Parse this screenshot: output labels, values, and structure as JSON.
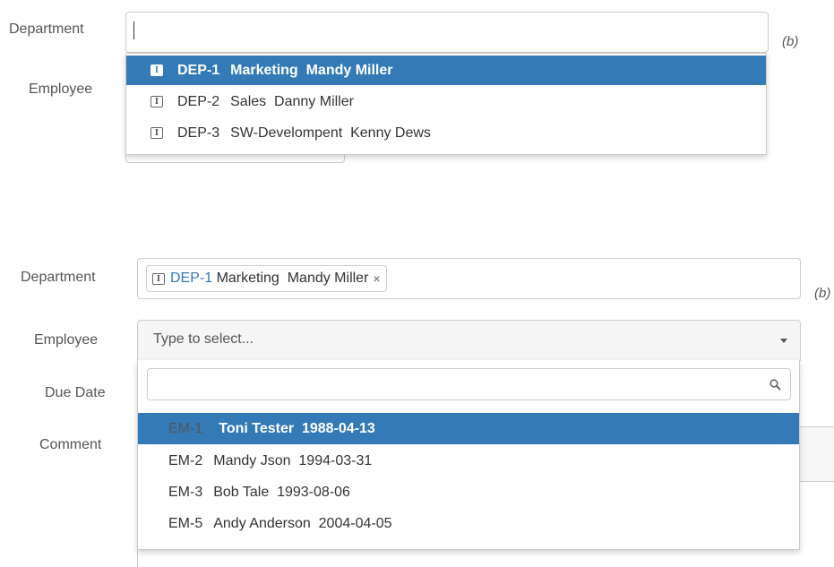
{
  "top": {
    "department_label": "Department",
    "employee_label": "Employee",
    "note": "(b)",
    "search_value": "",
    "options": [
      {
        "code": "DEP-1",
        "text": "Marketing  Mandy Miller",
        "selected": true
      },
      {
        "code": "DEP-2",
        "text": "Sales  Danny Miller",
        "selected": false
      },
      {
        "code": "DEP-3",
        "text": "SW-Develompent  Kenny Dews",
        "selected": false
      }
    ]
  },
  "bottom": {
    "department_label": "Department",
    "employee_label": "Employee",
    "due_date_label": "Due Date",
    "comment_label": "Comment",
    "note": "(b)",
    "selected_tag": {
      "code": "DEP-1",
      "text": " Marketing  Mandy Miller",
      "remove": "×"
    },
    "employee_placeholder": "Type to select...",
    "search_value": "",
    "options": [
      {
        "code": "EM-1",
        "text": "Toni Tester  1988-04-13",
        "selected": true
      },
      {
        "code": "EM-2",
        "text": "Mandy Json  1994-03-31",
        "selected": false
      },
      {
        "code": "EM-3",
        "text": "Bob Tale  1993-08-06",
        "selected": false
      },
      {
        "code": "EM-5",
        "text": "Andy Anderson  2004-04-05",
        "selected": false
      }
    ]
  },
  "colors": {
    "highlight": "#337ab7",
    "tag_code": "#337ab7"
  },
  "icons": {
    "tag": "id-icon",
    "search": "search-icon",
    "dropdown": "caret-down-icon"
  }
}
